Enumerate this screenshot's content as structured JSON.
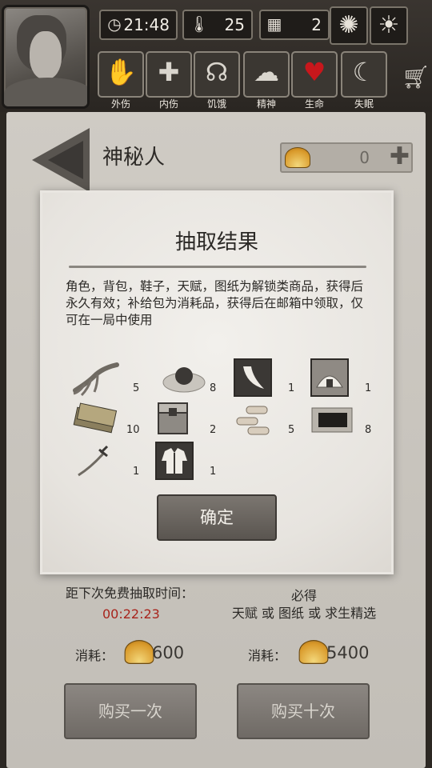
{
  "hud": {
    "time": "21:48",
    "temperature": "25",
    "day": "2",
    "status_icons": [
      {
        "label": "外伤",
        "icon": "hand-icon"
      },
      {
        "label": "内伤",
        "icon": "cross-icon"
      },
      {
        "label": "饥饿",
        "icon": "stomach-icon"
      },
      {
        "label": "精神",
        "icon": "brain-icon"
      },
      {
        "label": "生命",
        "icon": "heart-icon"
      },
      {
        "label": "失眠",
        "icon": "moon-icon"
      }
    ]
  },
  "page": {
    "title": "神秘人",
    "shells": "0"
  },
  "modal": {
    "title": "抽取结果",
    "description": "角色，背包，鞋子，天赋，图纸为解锁类商品，获得后永久有效；补给包为消耗品，获得后在邮箱中领取，仅可在一局中使用",
    "items": [
      {
        "icon": "ginseng-icon",
        "qty": "5"
      },
      {
        "icon": "iron-ore-icon",
        "qty": "8"
      },
      {
        "icon": "tooth-card-icon",
        "qty": "1"
      },
      {
        "icon": "igloo-card-icon",
        "qty": "1"
      },
      {
        "icon": "book-stack-icon",
        "qty": "10"
      },
      {
        "icon": "supply-box-icon",
        "qty": "2"
      },
      {
        "icon": "bones-icon",
        "qty": "5"
      },
      {
        "icon": "cloth-icon",
        "qty": "8"
      },
      {
        "icon": "sword-icon",
        "qty": "1"
      },
      {
        "icon": "jacket-card-icon",
        "qty": "1"
      }
    ],
    "confirm_label": "确定"
  },
  "footer": {
    "timer_label": "距下次免费抽取时间：",
    "timer": "00:22:23",
    "guarantee_line1": "必得",
    "guarantee_line2": "天赋 或 图纸 或 求生精选",
    "cost_label": "消耗：",
    "cost_single": "600",
    "cost_ten": "5400",
    "buy_one": "购买一次",
    "buy_ten": "购买十次"
  },
  "colors": {
    "timer_red": "#a8241c",
    "shell_gold": "#d99a2b",
    "heart_red": "#c8171c"
  }
}
